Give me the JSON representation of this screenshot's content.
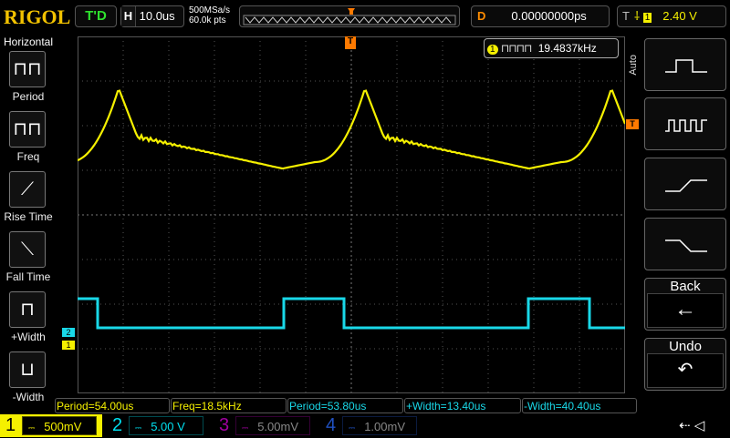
{
  "header": {
    "logo": "RIGOL",
    "run_state": "T'D",
    "h_label": "H",
    "timebase": "10.0us",
    "sample_rate": "500MSa/s",
    "mem_depth": "60.0k pts",
    "delay_label": "D",
    "delay": "0.00000000ps",
    "trig_label": "T",
    "trig_source": "1",
    "trig_level": "2.40 V"
  },
  "left_menu": {
    "title": "Horizontal",
    "items": [
      "Period",
      "Freq",
      "Rise Time",
      "Fall Time",
      "+Width",
      "-Width"
    ]
  },
  "freq_counter": {
    "channel": "1",
    "value": "19.4837kHz"
  },
  "right_menu": {
    "mode": "Auto",
    "back": "Back",
    "undo": "Undo"
  },
  "markers": {
    "ch2": "2",
    "ch1": "1",
    "trig": "T"
  },
  "measurements": [
    "Period=54.00us",
    "Freq=18.5kHz",
    "Period=53.80us",
    "+Width=13.40us",
    "-Width=40.40us"
  ],
  "channels": [
    {
      "num": "1",
      "scale": "500mV",
      "color": "#f5f000"
    },
    {
      "num": "2",
      "scale": "5.00 V",
      "color": "#00e0f0"
    },
    {
      "num": "3",
      "scale": "5.00mV",
      "color": "#a000a0"
    },
    {
      "num": "4",
      "scale": "1.00mV",
      "color": "#2050c0"
    }
  ]
}
